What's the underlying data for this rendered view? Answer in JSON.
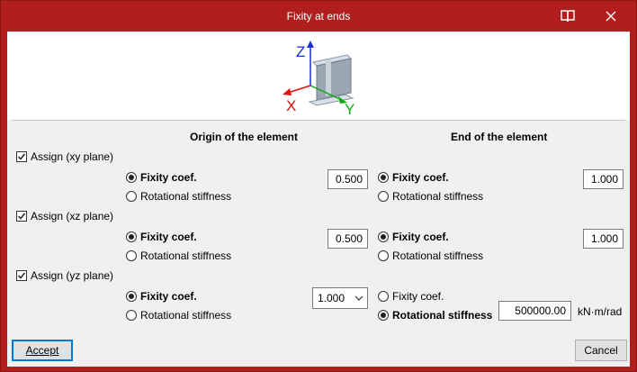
{
  "window": {
    "title": "Fixity at ends"
  },
  "columns": {
    "origin": "Origin of the element",
    "end": "End of the element"
  },
  "axes": {
    "z": "Z",
    "x": "X",
    "y": "Y"
  },
  "planes": [
    {
      "assign_label": "Assign (xy plane)",
      "checked": true,
      "origin": {
        "fixity_label": "Fixity coef.",
        "stiffness_label": "Rotational stiffness",
        "selected": "fixity",
        "value": "0.500"
      },
      "end": {
        "fixity_label": "Fixity coef.",
        "stiffness_label": "Rotational stiffness",
        "selected": "fixity",
        "value": "1.000"
      }
    },
    {
      "assign_label": "Assign (xz plane)",
      "checked": true,
      "origin": {
        "fixity_label": "Fixity coef.",
        "stiffness_label": "Rotational stiffness",
        "selected": "fixity",
        "value": "0.500"
      },
      "end": {
        "fixity_label": "Fixity coef.",
        "stiffness_label": "Rotational stiffness",
        "selected": "fixity",
        "value": "1.000"
      }
    },
    {
      "assign_label": "Assign (yz plane)",
      "checked": true,
      "origin": {
        "fixity_label": "Fixity coef.",
        "stiffness_label": "Rotational stiffness",
        "selected": "fixity",
        "value": "1.000"
      },
      "end": {
        "fixity_label": "Fixity coef.",
        "stiffness_label": "Rotational stiffness",
        "selected": "stiffness",
        "value": "500000.00",
        "unit": "kN·m/rad"
      }
    }
  ],
  "buttons": {
    "accept": "Accept",
    "cancel": "Cancel"
  },
  "icons": {
    "help": "book-icon",
    "close": "close-icon"
  },
  "colors": {
    "titlebar": "#b01e1e",
    "z_axis": "#1a2fd0",
    "x_axis": "#e01010",
    "y_axis": "#11aa11",
    "default_button_border": "#0078d7"
  }
}
